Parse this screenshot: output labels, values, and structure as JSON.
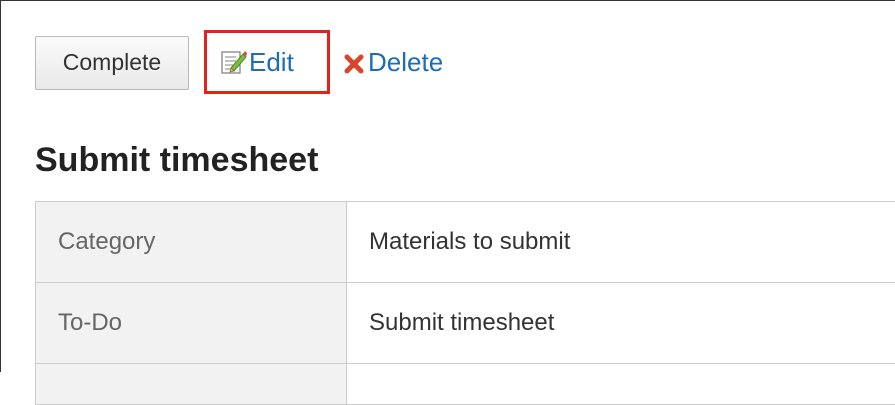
{
  "toolbar": {
    "complete_label": "Complete",
    "edit_label": "Edit",
    "delete_label": "Delete"
  },
  "todo": {
    "title": "Submit timesheet",
    "rows": [
      {
        "label": "Category",
        "value": "Materials to submit"
      },
      {
        "label": "To-Do",
        "value": "Submit timesheet"
      }
    ]
  },
  "colors": {
    "link": "#1d6db5",
    "highlight_box": "#e2231a",
    "delete_icon": "#d9452b",
    "label_cell_bg": "#f2f2f2"
  },
  "icons": {
    "edit": "edit-pencil-icon",
    "delete": "delete-x-icon"
  }
}
